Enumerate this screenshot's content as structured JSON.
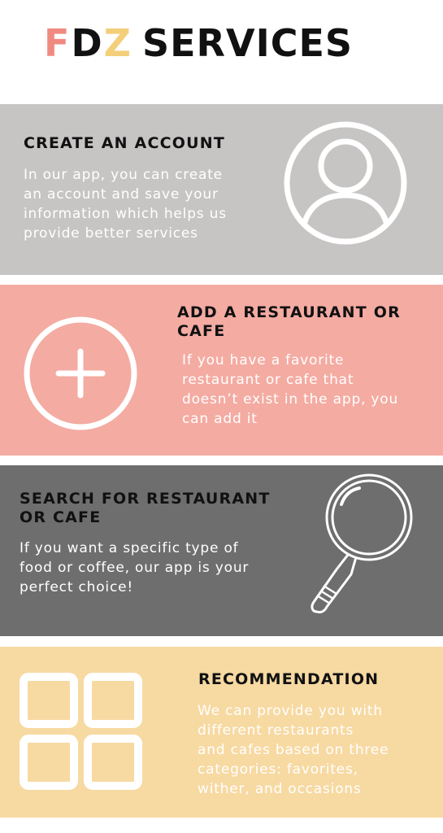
{
  "header": {
    "logo_letters": [
      "F",
      "D",
      "Z"
    ],
    "title": "SERVICES"
  },
  "sections": [
    {
      "heading": "CREATE AN ACCOUNT",
      "lines": [
        "In our app, you can create",
        "an account and save your",
        "information which helps us",
        "provide better services"
      ],
      "icon": "user-icon"
    },
    {
      "heading_lines": [
        "ADD A RESTAURANT OR",
        "CAFE"
      ],
      "lines": [
        "If you have a favorite",
        "restaurant or cafe that",
        "doesn’t exist in the app, you",
        "can add it"
      ],
      "icon": "plus-circle-icon"
    },
    {
      "heading_lines": [
        "SEARCH FOR RESTAURANT",
        "OR CAFE"
      ],
      "lines": [
        "If you want a specific type of",
        "food or coffee, our app is your",
        "perfect choice!"
      ],
      "icon": "magnifier-icon"
    },
    {
      "heading": "RECOMMENDATION",
      "lines": [
        "We can provide you with",
        "different restaurants",
        "and cafes based on three",
        "categories: favorites,",
        "wither, and occasions"
      ],
      "icon": "grid-icon"
    }
  ],
  "colors": {
    "logo_f": "#f08a80",
    "logo_d": "#111111",
    "logo_z": "#f3cf7a",
    "section_1_bg": "#c7c4c4",
    "section_2_bg": "#f4aba2",
    "section_3_bg": "#6e6e6e",
    "section_4_bg": "#f7d9a2"
  }
}
